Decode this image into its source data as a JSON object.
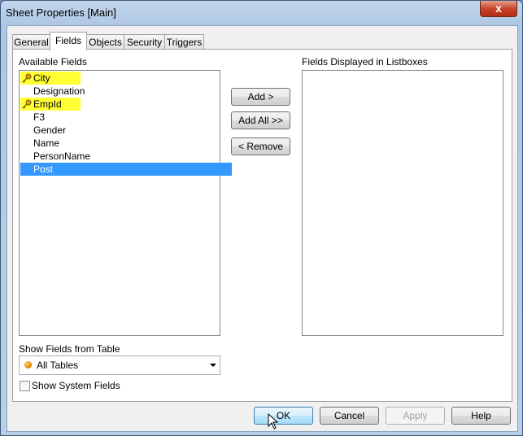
{
  "window": {
    "title": "Sheet Properties [Main]",
    "close_glyph": "x"
  },
  "tabs": [
    {
      "label": "General",
      "active": false
    },
    {
      "label": "Fields",
      "active": true
    },
    {
      "label": "Objects",
      "active": false
    },
    {
      "label": "Security",
      "active": false
    },
    {
      "label": "Triggers",
      "active": false
    }
  ],
  "available_fields": {
    "label": "Available Fields",
    "items": [
      {
        "label": "City",
        "key": true,
        "highlight": true,
        "selected": false
      },
      {
        "label": "Designation",
        "key": false,
        "highlight": false,
        "selected": false
      },
      {
        "label": "EmpId",
        "key": true,
        "highlight": true,
        "selected": false
      },
      {
        "label": "F3",
        "key": false,
        "highlight": false,
        "selected": false
      },
      {
        "label": "Gender",
        "key": false,
        "highlight": false,
        "selected": false
      },
      {
        "label": "Name",
        "key": false,
        "highlight": false,
        "selected": false
      },
      {
        "label": "PersonName",
        "key": false,
        "highlight": false,
        "selected": false
      },
      {
        "label": "Post",
        "key": false,
        "highlight": false,
        "selected": true
      }
    ]
  },
  "actions": {
    "add": "Add >",
    "add_all": "Add All >>",
    "remove": "< Remove"
  },
  "displayed_fields": {
    "label": "Fields Displayed in Listboxes",
    "items": []
  },
  "show_fields_from_table": {
    "label": "Show Fields from Table",
    "value": "All Tables"
  },
  "show_system_fields": {
    "label": "Show System Fields",
    "checked": false
  },
  "footer": {
    "ok": "OK",
    "cancel": "Cancel",
    "apply": "Apply",
    "help": "Help"
  },
  "colors": {
    "highlight": "#ffff33",
    "selection": "#3399ff",
    "close": "#c8452c"
  }
}
